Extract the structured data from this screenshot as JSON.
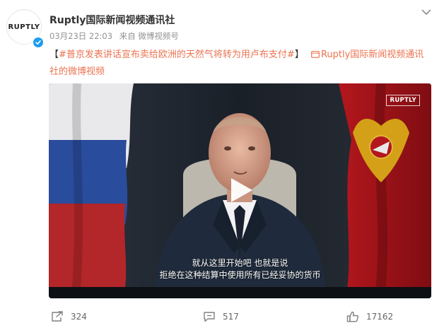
{
  "post": {
    "author_name": "Ruptly国际新闻视频通讯社",
    "avatar_text": "RUPTLY",
    "date": "03月23日 22:03",
    "source": "来自 微博视频号",
    "text": {
      "open_bracket": "【",
      "topic": "#普京发表讲话宣布卖给欧洲的天然气将转为用卢布支付#",
      "close_bracket": "】",
      "video_link": "Ruptly国际新闻视频通讯社的微博视频"
    }
  },
  "video": {
    "watermark": "RUPTLY",
    "subtitle_line1": "就从这里开始吧  也就是说",
    "subtitle_line2": "拒绝在这种结算中使用所有已经妥协的货币"
  },
  "actions": {
    "repost_count": "324",
    "comment_count": "517",
    "like_count": "17162"
  },
  "colors": {
    "accent": "#eb7350",
    "verified": "#1e9cf0",
    "meta": "#939393"
  }
}
